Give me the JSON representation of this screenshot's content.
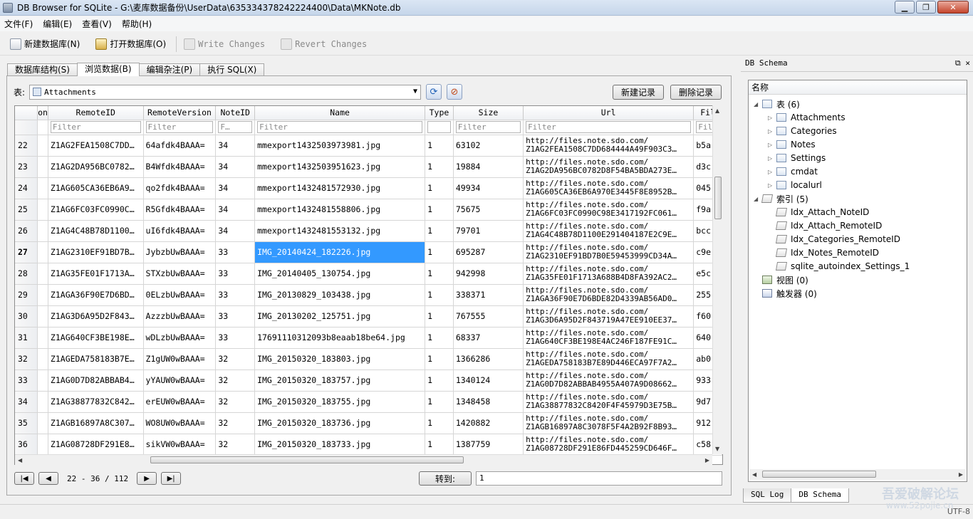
{
  "window": {
    "title": "DB Browser for SQLite - G:\\麦库数据备份\\UserData\\635334378242224400\\Data\\MKNote.db"
  },
  "menu": [
    "文件(F)",
    "编辑(E)",
    "查看(V)",
    "帮助(H)"
  ],
  "toolbar": {
    "new_db": "新建数据库(N)",
    "open_db": "打开数据库(O)",
    "write_changes": "Write Changes",
    "revert_changes": "Revert Changes"
  },
  "tabs": [
    "数据库结构(S)",
    "浏览数据(B)",
    "编辑杂注(P)",
    "执行 SQL(X)"
  ],
  "browse": {
    "table_label": "表:",
    "table_selected": "Attachments",
    "new_record": "新建记录",
    "delete_record": "删除记录",
    "goto_label": "转到:",
    "goto_value": "1",
    "nav_text": "22 - 36 / 112"
  },
  "grid": {
    "columns": [
      "on",
      "RemoteID",
      "RemoteVersion",
      "NoteID",
      "Name",
      "Type",
      "Size",
      "Url",
      "Fil"
    ],
    "filters": [
      "",
      "Filter",
      "Filter",
      "F…",
      "Filter",
      "",
      "Filter",
      "Filter",
      "Fil"
    ],
    "rows": [
      {
        "num": "22",
        "remoteid": "Z1AG2FEA1508C7DD…",
        "version": "64afdk4BAAA=",
        "noteid": "34",
        "name": "mmexport1432503973981.jpg",
        "type": "1",
        "size": "63102",
        "url1": "http://files.note.sdo.com/",
        "url2": "Z1AG2FEA1508C7DD684444A49F903C3…",
        "extra": "b5a"
      },
      {
        "num": "23",
        "remoteid": "Z1AG2DA956BC0782…",
        "version": "B4Wfdk4BAAA=",
        "noteid": "34",
        "name": "mmexport1432503951623.jpg",
        "type": "1",
        "size": "19884",
        "url1": "http://files.note.sdo.com/",
        "url2": "Z1AG2DA956BC0782D8F54BA5BDA273E…",
        "extra": "d3c"
      },
      {
        "num": "24",
        "remoteid": "Z1AG605CA36EB6A9…",
        "version": "qo2fdk4BAAA=",
        "noteid": "34",
        "name": "mmexport1432481572930.jpg",
        "type": "1",
        "size": "49934",
        "url1": "http://files.note.sdo.com/",
        "url2": "Z1AG605CA36EB6A970E3445F8E8952B…",
        "extra": "045"
      },
      {
        "num": "25",
        "remoteid": "Z1AG6FC03FC0990C…",
        "version": "R5Gfdk4BAAA=",
        "noteid": "34",
        "name": "mmexport1432481558806.jpg",
        "type": "1",
        "size": "75675",
        "url1": "http://files.note.sdo.com/",
        "url2": "Z1AG6FC03FC0990C98E3417192FC061…",
        "extra": "f9a"
      },
      {
        "num": "26",
        "remoteid": "Z1AG4C48B78D1100…",
        "version": "uI6fdk4BAAA=",
        "noteid": "34",
        "name": "mmexport1432481553132.jpg",
        "type": "1",
        "size": "79701",
        "url1": "http://files.note.sdo.com/",
        "url2": "Z1AG4C48B78D1100E291404187E2C9E…",
        "extra": "bcc"
      },
      {
        "num": "27",
        "remoteid": "Z1AG2310EF91BD7B…",
        "version": "JybzbUwBAAA=",
        "noteid": "33",
        "name": "IMG_20140424_182226.jpg",
        "type": "1",
        "size": "695287",
        "url1": "http://files.note.sdo.com/",
        "url2": "Z1AG2310EF91BD7B0E59453999CD34A…",
        "extra": "c9e"
      },
      {
        "num": "28",
        "remoteid": "Z1AG35FE01F1713A…",
        "version": "STXzbUwBAAA=",
        "noteid": "33",
        "name": "IMG_20140405_130754.jpg",
        "type": "1",
        "size": "942998",
        "url1": "http://files.note.sdo.com/",
        "url2": "Z1AG35FE01F1713A688B4D8FA392AC2…",
        "extra": "e5c"
      },
      {
        "num": "29",
        "remoteid": "Z1AGA36F90E7D6BD…",
        "version": "0ELzbUwBAAA=",
        "noteid": "33",
        "name": "IMG_20130829_103438.jpg",
        "type": "1",
        "size": "338371",
        "url1": "http://files.note.sdo.com/",
        "url2": "Z1AGA36F90E7D6BDE82D4339AB56AD0…",
        "extra": "255"
      },
      {
        "num": "30",
        "remoteid": "Z1AG3D6A95D2F843…",
        "version": "AzzzbUwBAAA=",
        "noteid": "33",
        "name": "IMG_20130202_125751.jpg",
        "type": "1",
        "size": "767555",
        "url1": "http://files.note.sdo.com/",
        "url2": "Z1AG3D6A95D2F843719A47EE910EE37…",
        "extra": "f60"
      },
      {
        "num": "31",
        "remoteid": "Z1AG640CF3BE198E…",
        "version": "wDLzbUwBAAA=",
        "noteid": "33",
        "name": "17691110312093b8eaab18be64.jpg",
        "type": "1",
        "size": "68337",
        "url1": "http://files.note.sdo.com/",
        "url2": "Z1AG640CF3BE198E4AC246F187FE91C…",
        "extra": "640"
      },
      {
        "num": "32",
        "remoteid": "Z1AGEDA758183B7E…",
        "version": "Z1gUW0wBAAA=",
        "noteid": "32",
        "name": "IMG_20150320_183803.jpg",
        "type": "1",
        "size": "1366286",
        "url1": "http://files.note.sdo.com/",
        "url2": "Z1AGEDA758183B7E89D446ECA97F7A2…",
        "extra": "ab0"
      },
      {
        "num": "33",
        "remoteid": "Z1AG0D7D82ABBAB4…",
        "version": "yYAUW0wBAAA=",
        "noteid": "32",
        "name": "IMG_20150320_183757.jpg",
        "type": "1",
        "size": "1340124",
        "url1": "http://files.note.sdo.com/",
        "url2": "Z1AG0D7D82ABBAB4955A407A9D08662…",
        "extra": "933"
      },
      {
        "num": "34",
        "remoteid": "Z1AG38877832C842…",
        "version": "erEUW0wBAAA=",
        "noteid": "32",
        "name": "IMG_20150320_183755.jpg",
        "type": "1",
        "size": "1348458",
        "url1": "http://files.note.sdo.com/",
        "url2": "Z1AG38877832C8420F4F45979D3E75B…",
        "extra": "9d7"
      },
      {
        "num": "35",
        "remoteid": "Z1AGB16897A8C307…",
        "version": "WO8UW0wBAAA=",
        "noteid": "32",
        "name": "IMG_20150320_183736.jpg",
        "type": "1",
        "size": "1420882",
        "url1": "http://files.note.sdo.com/",
        "url2": "Z1AGB16897A8C3078F5F4A2B92F8B93…",
        "extra": "912"
      },
      {
        "num": "36",
        "remoteid": "Z1AG08728DF291E8…",
        "version": "sikVW0wBAAA=",
        "noteid": "32",
        "name": "IMG_20150320_183733.jpg",
        "type": "1",
        "size": "1387759",
        "url1": "http://files.note.sdo.com/",
        "url2": "Z1AG08728DF291E86FD445259CD646F…",
        "extra": "c58"
      }
    ]
  },
  "schema": {
    "dock_title": "DB Schema",
    "header": "名称",
    "tables_label": "表 (6)",
    "tables": [
      "Attachments",
      "Categories",
      "Notes",
      "Settings",
      "cmdat",
      "localurl"
    ],
    "indexes_label": "索引 (5)",
    "indexes": [
      "Idx_Attach_NoteID",
      "Idx_Attach_RemoteID",
      "Idx_Categories_RemoteID",
      "Idx_Notes_RemoteID",
      "sqlite_autoindex_Settings_1"
    ],
    "views_label": "视图 (0)",
    "triggers_label": "触发器 (0)"
  },
  "dock_tabs": [
    "SQL Log",
    "DB Schema"
  ],
  "status": {
    "encoding": "UTF-8",
    "watermark": "吾爱破解论坛",
    "watermark_url": "www.52pojie.cn"
  }
}
